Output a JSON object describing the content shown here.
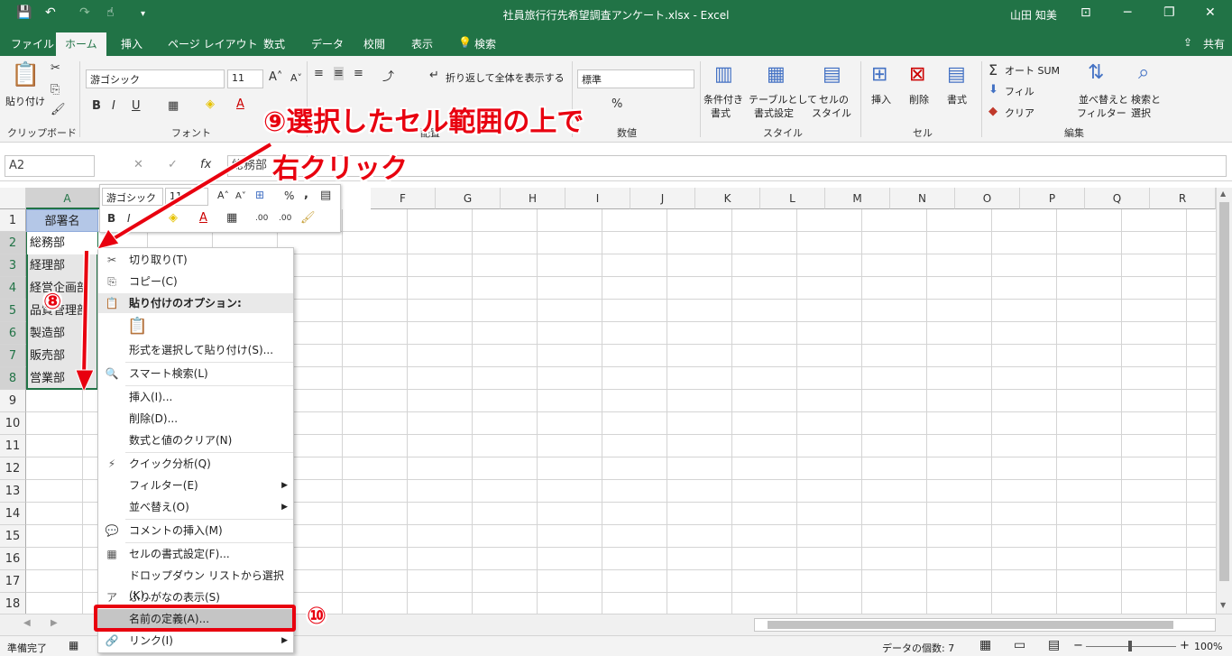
{
  "titlebar": {
    "title": "社員旅行行先希望調査アンケート.xlsx  -  Excel",
    "user": "山田 知美",
    "minimize": "─",
    "restore": "❐",
    "close": "✕"
  },
  "tabs": [
    {
      "label": "ファイル"
    },
    {
      "label": "ホーム"
    },
    {
      "label": "挿入"
    },
    {
      "label": "ページ レイアウト"
    },
    {
      "label": "数式"
    },
    {
      "label": "データ"
    },
    {
      "label": "校閲"
    },
    {
      "label": "表示"
    },
    {
      "label": "検索"
    }
  ],
  "share_label": "共有",
  "ribbon": {
    "paste": "貼り付け",
    "clipboard": "クリップボード",
    "font_name": "游ゴシック",
    "font_size": "11",
    "font_group": "フォント",
    "wrap_text": "折り返して全体を表示する",
    "alignment_group": "配置",
    "number_format": "標準",
    "number_group": "数値",
    "cond_format_1": "条件付き",
    "cond_format_2": "書式",
    "table_format_1": "テーブルとして",
    "table_format_2": "書式設定",
    "cell_style_1": "セルの",
    "cell_style_2": "スタイル",
    "style_group": "スタイル",
    "insert": "挿入",
    "delete": "削除",
    "format": "書式",
    "cells_group": "セル",
    "autosum": "オート SUM",
    "fill": "フィル",
    "clear": "クリア",
    "sort_1": "並べ替えと",
    "sort_2": "フィルター",
    "find_1": "検索と",
    "find_2": "選択",
    "editing_group": "編集"
  },
  "formula_bar": {
    "name_box": "A2",
    "cancel": "✕",
    "enter": "✓",
    "fx": "fx",
    "content": "総務部"
  },
  "grid": {
    "columns": [
      "A",
      "B",
      "C",
      "D",
      "E",
      "F",
      "G",
      "H",
      "I",
      "J",
      "K",
      "L",
      "M",
      "N",
      "O",
      "P",
      "Q",
      "R"
    ],
    "rows": [
      "1",
      "2",
      "3",
      "4",
      "5",
      "6",
      "7",
      "8",
      "9",
      "10",
      "11",
      "12",
      "13",
      "14",
      "15",
      "16",
      "17",
      "18"
    ],
    "header_cell": "部署名",
    "data": [
      "総務部",
      "経理部",
      "経営企画部",
      "品質管理部",
      "製造部",
      "販売部",
      "営業部"
    ]
  },
  "mini_toolbar": {
    "font": "游ゴシック",
    "size": "11",
    "percent": "%",
    "comma": ",",
    "bold": "B",
    "italic": "I",
    "font_color": "A",
    "inc_decimal": ".00",
    "dec_decimal": ".00"
  },
  "context_menu": {
    "items": [
      {
        "label": "切り取り(T)",
        "icon": "✂"
      },
      {
        "label": "コピー(C)",
        "icon": "⎘"
      },
      {
        "label": "貼り付けのオプション:",
        "icon": "📋"
      },
      {
        "label": "形式を選択して貼り付け(S)...",
        "icon": ""
      },
      {
        "label": "スマート検索(L)",
        "icon": "🔍"
      },
      {
        "label": "挿入(I)...",
        "icon": ""
      },
      {
        "label": "削除(D)...",
        "icon": ""
      },
      {
        "label": "数式と値のクリア(N)",
        "icon": ""
      },
      {
        "label": "クイック分析(Q)",
        "icon": "⚡"
      },
      {
        "label": "フィルター(E)",
        "icon": ""
      },
      {
        "label": "並べ替え(O)",
        "icon": ""
      },
      {
        "label": "コメントの挿入(M)",
        "icon": "💬"
      },
      {
        "label": "セルの書式設定(F)...",
        "icon": "▦"
      },
      {
        "label": "ドロップダウン リストから選択(K)...",
        "icon": ""
      },
      {
        "label": "ふりがなの表示(S)",
        "icon": "ア"
      },
      {
        "label": "名前の定義(A)...",
        "icon": ""
      },
      {
        "label": "リンク(I)",
        "icon": "🔗"
      }
    ]
  },
  "status": {
    "ready": "準備完了",
    "count": "データの個数: 7",
    "zoom": "100%",
    "minus": "−",
    "plus": "+"
  },
  "annotations": {
    "step9_line1": "⑨選択したセル範囲の上で",
    "step9_line2": "右クリック",
    "step8": "⑧",
    "step10": "⑩"
  }
}
